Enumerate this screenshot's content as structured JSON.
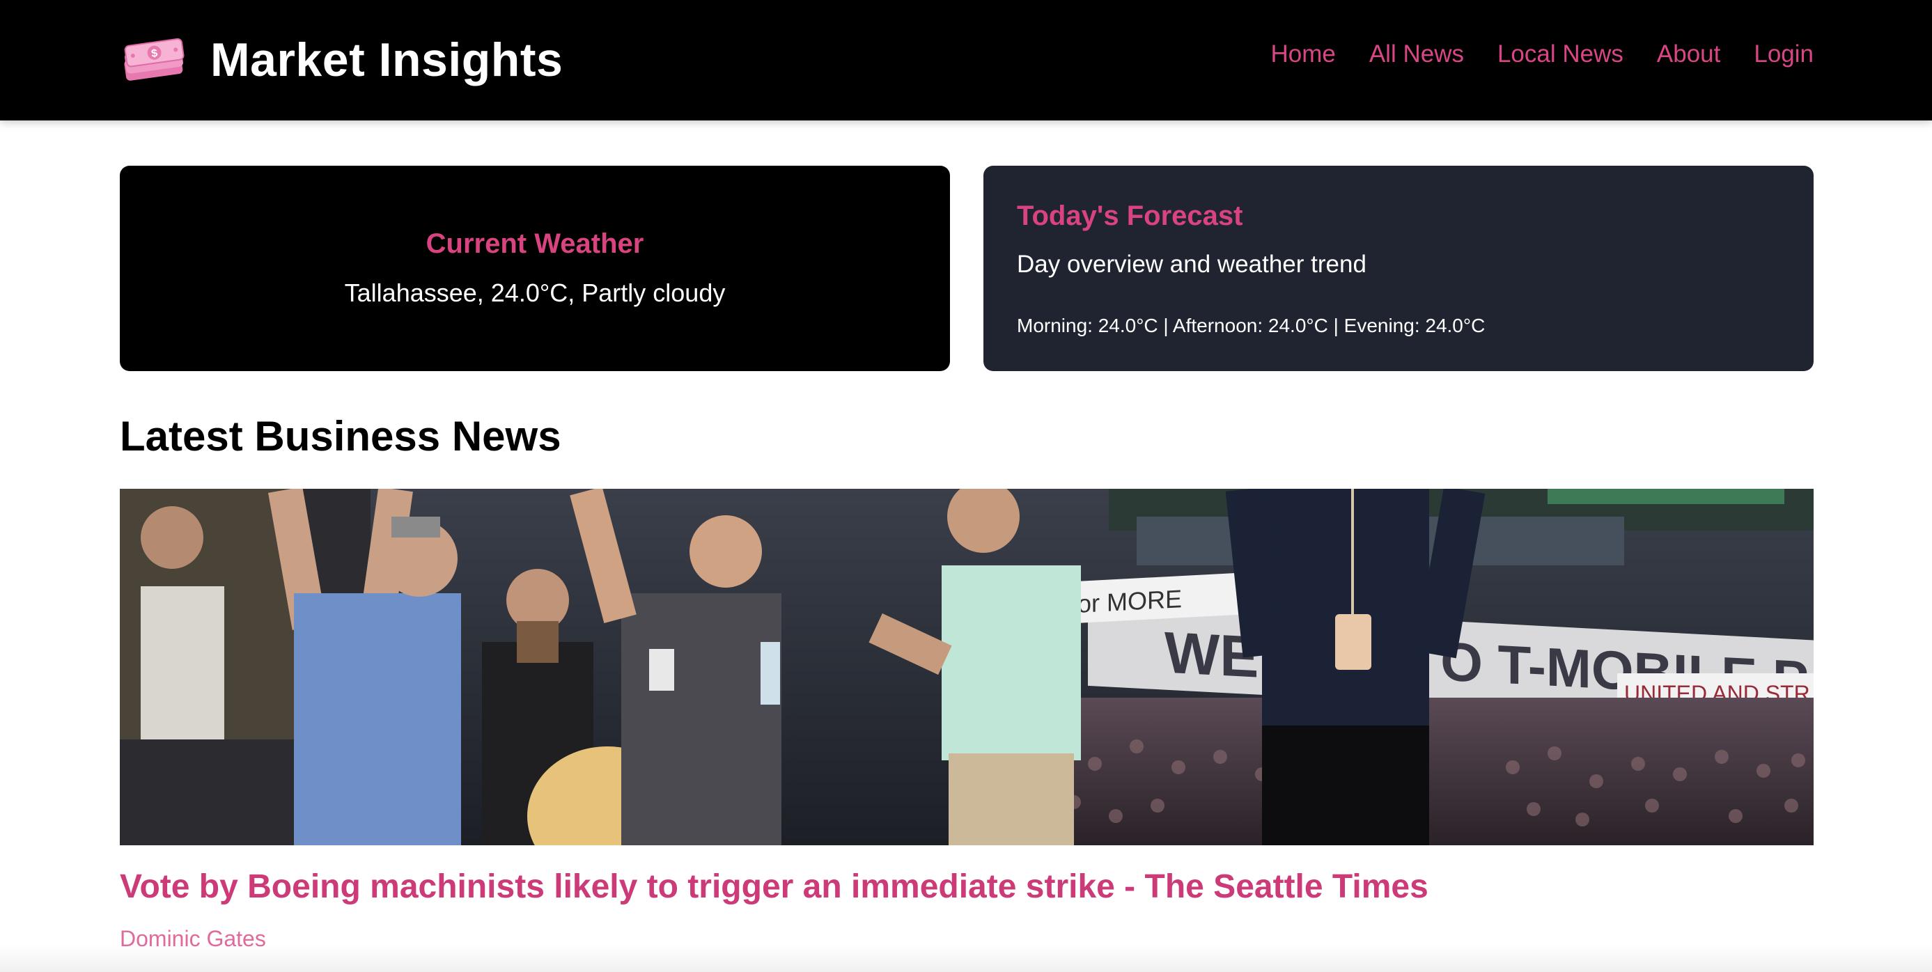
{
  "header": {
    "logo_icon": "money-stack-icon",
    "title": "Market Insights",
    "nav": [
      {
        "label": "Home"
      },
      {
        "label": "All News"
      },
      {
        "label": "Local News"
      },
      {
        "label": "About"
      },
      {
        "label": "Login"
      }
    ]
  },
  "weather": {
    "current": {
      "title": "Current Weather",
      "text": "Tallahassee, 24.0°C, Partly cloudy"
    },
    "forecast": {
      "title": "Today's Forecast",
      "subtitle": "Day overview and weather trend",
      "detail": "Morning: 24.0°C | Afternoon: 24.0°C | Evening: 24.0°C"
    }
  },
  "news": {
    "heading": "Latest Business News",
    "articles": [
      {
        "image_icon": "stadium-crowd-photo",
        "banner_text": "TO T-MOBILE PAR",
        "sign_left": "for MORE",
        "sign_right": "UNITED AND STR",
        "title": "Vote by Boeing machinists likely to trigger an immediate strike - The Seattle Times",
        "author": "Dominic Gates"
      }
    ]
  },
  "colors": {
    "accent": "#d9437f",
    "header_bg": "#000000",
    "forecast_bg": "#1f2430"
  }
}
